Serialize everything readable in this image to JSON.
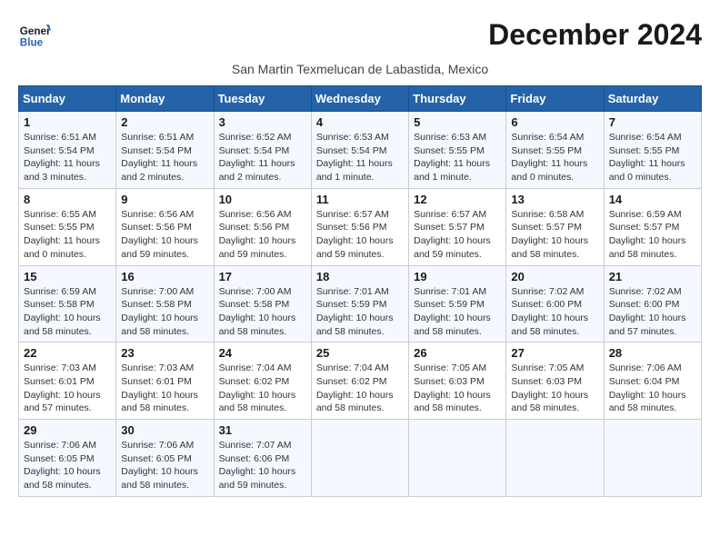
{
  "logo": {
    "line1": "General",
    "line2": "Blue"
  },
  "title": "December 2024",
  "location": "San Martin Texmelucan de Labastida, Mexico",
  "headers": [
    "Sunday",
    "Monday",
    "Tuesday",
    "Wednesday",
    "Thursday",
    "Friday",
    "Saturday"
  ],
  "weeks": [
    [
      {
        "day": "1",
        "sunrise": "6:51 AM",
        "sunset": "5:54 PM",
        "daylight": "11 hours and 3 minutes."
      },
      {
        "day": "2",
        "sunrise": "6:51 AM",
        "sunset": "5:54 PM",
        "daylight": "11 hours and 2 minutes."
      },
      {
        "day": "3",
        "sunrise": "6:52 AM",
        "sunset": "5:54 PM",
        "daylight": "11 hours and 2 minutes."
      },
      {
        "day": "4",
        "sunrise": "6:53 AM",
        "sunset": "5:54 PM",
        "daylight": "11 hours and 1 minute."
      },
      {
        "day": "5",
        "sunrise": "6:53 AM",
        "sunset": "5:55 PM",
        "daylight": "11 hours and 1 minute."
      },
      {
        "day": "6",
        "sunrise": "6:54 AM",
        "sunset": "5:55 PM",
        "daylight": "11 hours and 0 minutes."
      },
      {
        "day": "7",
        "sunrise": "6:54 AM",
        "sunset": "5:55 PM",
        "daylight": "11 hours and 0 minutes."
      }
    ],
    [
      {
        "day": "8",
        "sunrise": "6:55 AM",
        "sunset": "5:55 PM",
        "daylight": "11 hours and 0 minutes."
      },
      {
        "day": "9",
        "sunrise": "6:56 AM",
        "sunset": "5:56 PM",
        "daylight": "10 hours and 59 minutes."
      },
      {
        "day": "10",
        "sunrise": "6:56 AM",
        "sunset": "5:56 PM",
        "daylight": "10 hours and 59 minutes."
      },
      {
        "day": "11",
        "sunrise": "6:57 AM",
        "sunset": "5:56 PM",
        "daylight": "10 hours and 59 minutes."
      },
      {
        "day": "12",
        "sunrise": "6:57 AM",
        "sunset": "5:57 PM",
        "daylight": "10 hours and 59 minutes."
      },
      {
        "day": "13",
        "sunrise": "6:58 AM",
        "sunset": "5:57 PM",
        "daylight": "10 hours and 58 minutes."
      },
      {
        "day": "14",
        "sunrise": "6:59 AM",
        "sunset": "5:57 PM",
        "daylight": "10 hours and 58 minutes."
      }
    ],
    [
      {
        "day": "15",
        "sunrise": "6:59 AM",
        "sunset": "5:58 PM",
        "daylight": "10 hours and 58 minutes."
      },
      {
        "day": "16",
        "sunrise": "7:00 AM",
        "sunset": "5:58 PM",
        "daylight": "10 hours and 58 minutes."
      },
      {
        "day": "17",
        "sunrise": "7:00 AM",
        "sunset": "5:58 PM",
        "daylight": "10 hours and 58 minutes."
      },
      {
        "day": "18",
        "sunrise": "7:01 AM",
        "sunset": "5:59 PM",
        "daylight": "10 hours and 58 minutes."
      },
      {
        "day": "19",
        "sunrise": "7:01 AM",
        "sunset": "5:59 PM",
        "daylight": "10 hours and 58 minutes."
      },
      {
        "day": "20",
        "sunrise": "7:02 AM",
        "sunset": "6:00 PM",
        "daylight": "10 hours and 58 minutes."
      },
      {
        "day": "21",
        "sunrise": "7:02 AM",
        "sunset": "6:00 PM",
        "daylight": "10 hours and 57 minutes."
      }
    ],
    [
      {
        "day": "22",
        "sunrise": "7:03 AM",
        "sunset": "6:01 PM",
        "daylight": "10 hours and 57 minutes."
      },
      {
        "day": "23",
        "sunrise": "7:03 AM",
        "sunset": "6:01 PM",
        "daylight": "10 hours and 58 minutes."
      },
      {
        "day": "24",
        "sunrise": "7:04 AM",
        "sunset": "6:02 PM",
        "daylight": "10 hours and 58 minutes."
      },
      {
        "day": "25",
        "sunrise": "7:04 AM",
        "sunset": "6:02 PM",
        "daylight": "10 hours and 58 minutes."
      },
      {
        "day": "26",
        "sunrise": "7:05 AM",
        "sunset": "6:03 PM",
        "daylight": "10 hours and 58 minutes."
      },
      {
        "day": "27",
        "sunrise": "7:05 AM",
        "sunset": "6:03 PM",
        "daylight": "10 hours and 58 minutes."
      },
      {
        "day": "28",
        "sunrise": "7:06 AM",
        "sunset": "6:04 PM",
        "daylight": "10 hours and 58 minutes."
      }
    ],
    [
      {
        "day": "29",
        "sunrise": "7:06 AM",
        "sunset": "6:05 PM",
        "daylight": "10 hours and 58 minutes."
      },
      {
        "day": "30",
        "sunrise": "7:06 AM",
        "sunset": "6:05 PM",
        "daylight": "10 hours and 58 minutes."
      },
      {
        "day": "31",
        "sunrise": "7:07 AM",
        "sunset": "6:06 PM",
        "daylight": "10 hours and 59 minutes."
      },
      null,
      null,
      null,
      null
    ]
  ]
}
